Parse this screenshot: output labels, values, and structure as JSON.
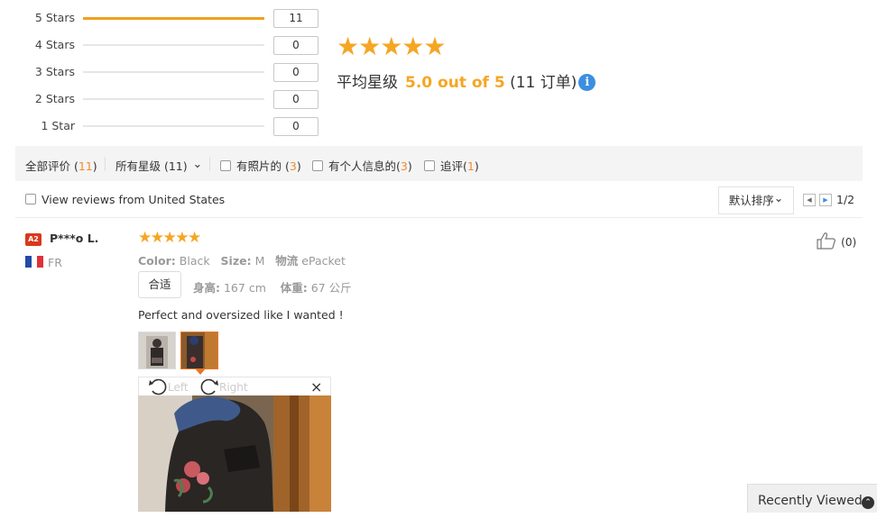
{
  "histogram": {
    "rows": [
      {
        "label": "5 Stars",
        "count": "11",
        "fill_fraction": 1.0
      },
      {
        "label": "4 Stars",
        "count": "0",
        "fill_fraction": 0
      },
      {
        "label": "3 Stars",
        "count": "0",
        "fill_fraction": 0
      },
      {
        "label": "2 Stars",
        "count": "0",
        "fill_fraction": 0
      },
      {
        "label": "1 Star",
        "count": "0",
        "fill_fraction": 0
      }
    ]
  },
  "summary": {
    "stars": "★★★★★",
    "prefix": "平均星级",
    "score": "5.0 out of 5",
    "orders": "(11 订单)",
    "info_glyph": "i"
  },
  "filters": {
    "all_reviews": "全部评价 (",
    "all_reviews_count": "11",
    "all_reviews_close": ")",
    "all_stars": "所有星级 (11)",
    "all_stars_caret": "⌄",
    "photos": "有照片的 (",
    "photos_count": "3",
    "photos_close": ")",
    "personal": "有个人信息的(",
    "personal_count": "3",
    "personal_close": ")",
    "followup": "追评(",
    "followup_count": "1",
    "followup_close": ")"
  },
  "toolbar": {
    "us_reviews": "View reviews from United States",
    "sort": "默认排序",
    "sort_caret": "⌄",
    "prev": "◀",
    "next": "▶",
    "page": "1/2"
  },
  "review": {
    "badge": "A2",
    "name": "P***o L.",
    "country": "FR",
    "stars": "★★★★★",
    "color_label": "Color:",
    "color_value": "Black",
    "size_label": "Size:",
    "size_value": "M",
    "shipping_label": "物流",
    "shipping_value": "ePacket",
    "fit": "合适",
    "height_label": "身高:",
    "height_value": "167 cm",
    "weight_label": "体重:",
    "weight_value": "67 公斤",
    "text": "Perfect and oversized like I wanted !",
    "likes": "(0)",
    "rotate_left": "Left",
    "rotate_right": "Right",
    "close": "×"
  },
  "recently_viewed": {
    "label": "Recently Viewed",
    "icon": "⌃"
  },
  "colors": {
    "accent_orange": "#f5a623",
    "count_orange": "#f08c30",
    "badge_red": "#d9381e",
    "info_blue": "#3b8fe0"
  }
}
